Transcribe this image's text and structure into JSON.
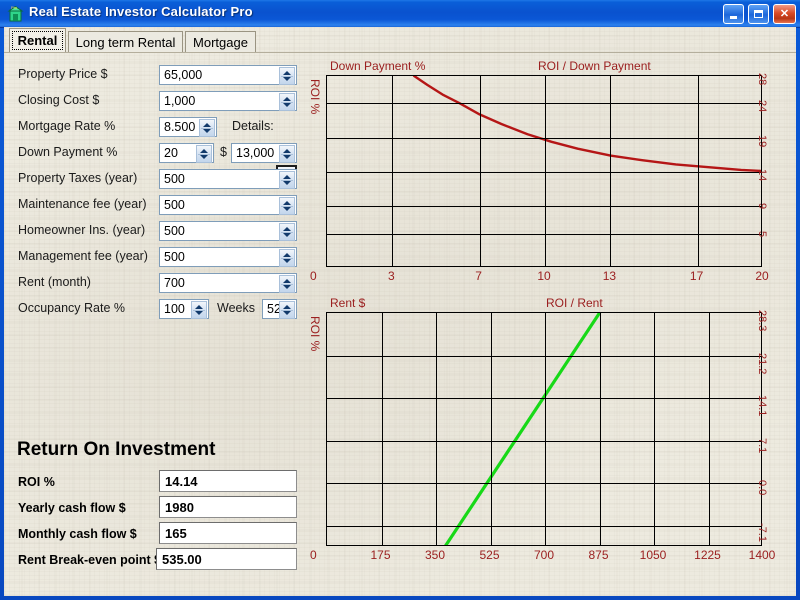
{
  "window": {
    "title": "Real Estate Investor Calculator Pro",
    "icon": "house-pro-icon",
    "minimize_label": "",
    "maximize_label": "",
    "close_label": "✕",
    "titlebar_color": "#0a52cf",
    "client_bg": "#efece2"
  },
  "tabs": [
    {
      "label": "Rental",
      "active": true
    },
    {
      "label": "Long term Rental",
      "active": false
    },
    {
      "label": "Mortgage",
      "active": false
    }
  ],
  "form": {
    "fields": [
      {
        "label": "Property Price $",
        "value": "65,000"
      },
      {
        "label": "Closing Cost $",
        "value": "1,000"
      },
      {
        "label": "Mortgage Rate %",
        "value": "8.500"
      },
      {
        "label": "Down Payment %",
        "value": "20"
      },
      {
        "label": "Property Taxes (year)",
        "value": "500"
      },
      {
        "label": "Maintenance fee (year)",
        "value": "500"
      },
      {
        "label": "Homeowner Ins. (year)",
        "value": "500"
      },
      {
        "label": "Management fee (year)",
        "value": "500"
      },
      {
        "label": "Rent (month)",
        "value": "700"
      },
      {
        "label": "Occupancy Rate %",
        "value": "100"
      }
    ],
    "details_label": "Details:",
    "details_icon": "chevron-double-down-icon",
    "down_payment_dollar_symbol": "$",
    "down_payment_dollar_value": "13,000",
    "weeks_label": "Weeks",
    "weeks_value": "52"
  },
  "roi": {
    "heading": "Return On Investment",
    "rows": [
      {
        "label": "ROI %",
        "value": "14.14"
      },
      {
        "label": "Yearly cash flow $",
        "value": "1980"
      },
      {
        "label": "Monthly cash flow $",
        "value": "165"
      },
      {
        "label": "Rent Break-even point $",
        "value": "535.00"
      }
    ]
  },
  "chart_data": [
    {
      "type": "line",
      "name": "roi-down-payment-chart",
      "title": "ROI / Down Payment",
      "xlabel": "Down Payment %",
      "ylabel": "ROI %",
      "x_origin_label": "0",
      "line_color": "#b51616",
      "grid": true,
      "xlim": [
        0,
        20
      ],
      "xticks": [
        "0",
        "3",
        "7",
        "10",
        "13",
        "17",
        "20"
      ],
      "xtick_values": [
        0,
        3,
        7,
        10,
        13,
        17,
        20
      ],
      "ylim": [
        0,
        28
      ],
      "yticks": [
        "28",
        "24",
        "19",
        "14",
        "9",
        "5"
      ],
      "ytick_values": [
        28,
        24,
        19,
        14,
        9,
        5
      ],
      "x": [
        4.0,
        4.6,
        5.3,
        6.1,
        7.0,
        8.0,
        9.2,
        10.3,
        11.5,
        13.0,
        14.5,
        16.0,
        17.5,
        19.0,
        20.0
      ],
      "y": [
        28.0,
        26.7,
        25.3,
        24.0,
        22.4,
        21.0,
        19.5,
        18.4,
        17.4,
        16.4,
        15.7,
        15.1,
        14.7,
        14.3,
        14.14
      ]
    },
    {
      "type": "line",
      "name": "roi-rent-chart",
      "title": "ROI / Rent",
      "xlabel": "Rent $",
      "ylabel": "ROI %",
      "x_origin_label": "0",
      "line_color": "#17d917",
      "grid": true,
      "xlim": [
        0,
        1400
      ],
      "xticks": [
        "0",
        "175",
        "350",
        "525",
        "700",
        "875",
        "1050",
        "1225",
        "1400"
      ],
      "xtick_values": [
        0,
        175,
        350,
        525,
        700,
        875,
        1050,
        1225,
        1400
      ],
      "ylim": [
        -10.6,
        28.3
      ],
      "yticks": [
        "28.3",
        "21.2",
        "14.1",
        "7.1",
        "0.0",
        "-7.1"
      ],
      "ytick_values": [
        28.3,
        21.2,
        14.1,
        7.1,
        0.0,
        -7.1
      ],
      "x": [
        378,
        875
      ],
      "y": [
        -10.6,
        28.3
      ]
    }
  ]
}
